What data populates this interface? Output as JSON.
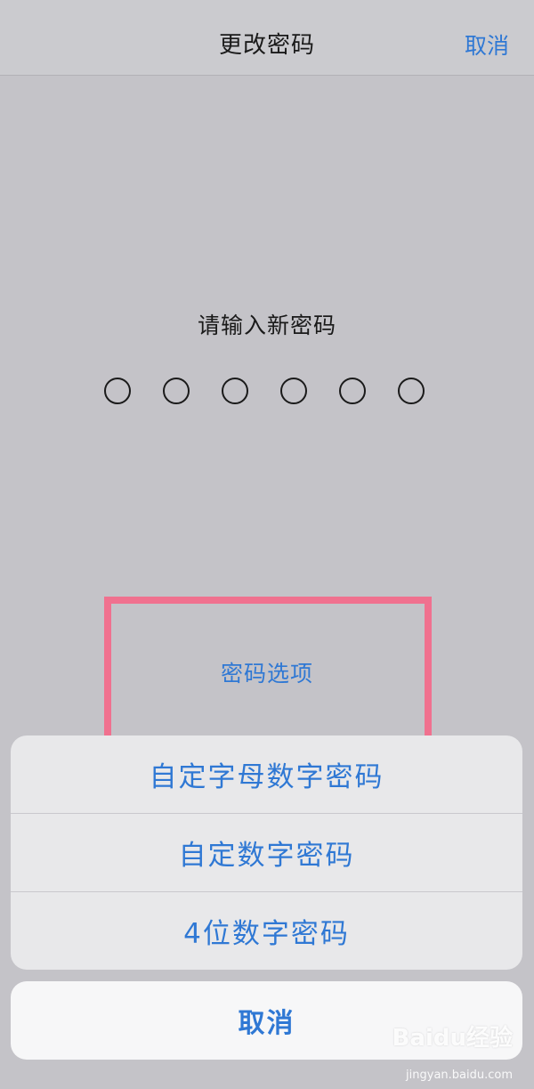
{
  "navbar": {
    "title": "更改密码",
    "cancel_label": "取消"
  },
  "passcode": {
    "prompt": "请输入新密码",
    "digits_total": 6,
    "digits_entered": 0
  },
  "options_sheet": {
    "title": "密码选项",
    "options": [
      {
        "label": "自定字母数字密码"
      },
      {
        "label": "自定数字密码"
      },
      {
        "label": "4位数字密码"
      }
    ],
    "cancel_label": "取消"
  },
  "watermark": {
    "logo_text": "Baidu经验",
    "url": "jingyan.baidu.com"
  },
  "colors": {
    "accent": "#2f78d4",
    "highlight": "#f0718f",
    "background": "#c4c3c8"
  }
}
